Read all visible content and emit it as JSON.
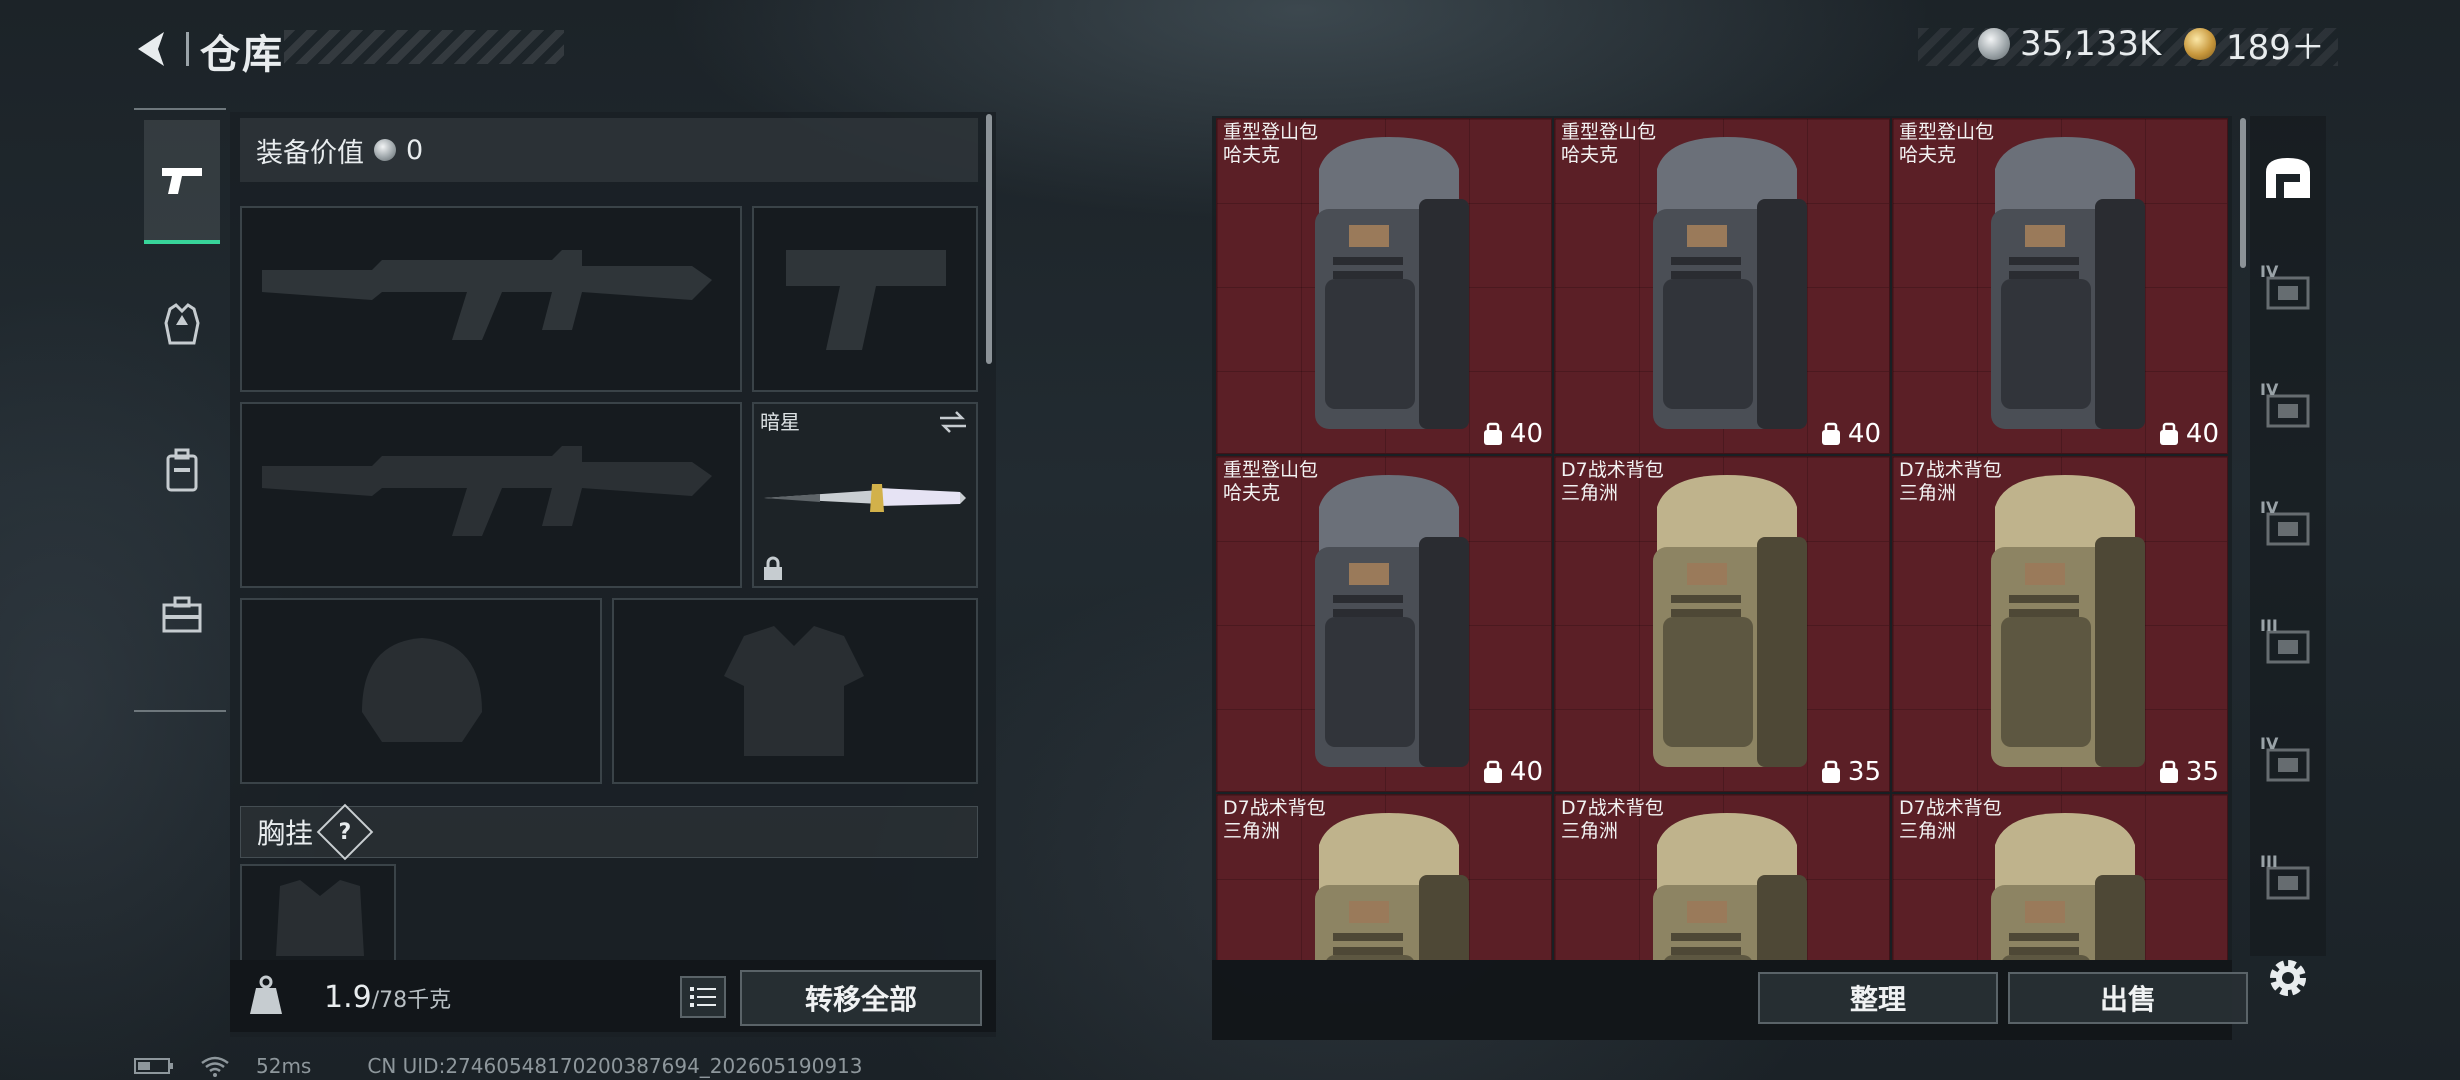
{
  "header": {
    "title": "仓库",
    "currency_silver": "35,133K",
    "currency_gold": "189＋"
  },
  "left_rail": {
    "tabs": [
      "weapon-icon",
      "armor-icon",
      "backpack-icon",
      "toolbox-icon"
    ],
    "active": 0
  },
  "equipment": {
    "value_label": "装备价值",
    "value_amount": "0",
    "melee_name": "暗星",
    "chest_rig_label": "胸挂",
    "help_label": "?"
  },
  "left_bottom": {
    "weight_current": "1.9",
    "weight_max": "/78千克",
    "transfer_all": "转移全部"
  },
  "storage": {
    "items": [
      {
        "line1": "重型登山包",
        "line2": "哈夫克",
        "capacity": "40",
        "variant": "gray"
      },
      {
        "line1": "重型登山包",
        "line2": "哈夫克",
        "capacity": "40",
        "variant": "gray"
      },
      {
        "line1": "重型登山包",
        "line2": "哈夫克",
        "capacity": "40",
        "variant": "gray"
      },
      {
        "line1": "重型登山包",
        "line2": "哈夫克",
        "capacity": "40",
        "variant": "gray"
      },
      {
        "line1": "D7战术背包",
        "line2": "三角洲",
        "capacity": "35",
        "variant": "tan"
      },
      {
        "line1": "D7战术背包",
        "line2": "三角洲",
        "capacity": "35",
        "variant": "tan"
      },
      {
        "line1": "D7战术背包",
        "line2": "三角洲",
        "capacity": "",
        "variant": "tan"
      },
      {
        "line1": "D7战术背包",
        "line2": "三角洲",
        "capacity": "",
        "variant": "tan"
      },
      {
        "line1": "D7战术背包",
        "line2": "三角洲",
        "capacity": "",
        "variant": "tan"
      }
    ],
    "sort_button": "整理",
    "sell_button": "出售"
  },
  "side_rail": {
    "icons": [
      "storage-home-icon",
      "tier-iv-case-icon",
      "tier-iv-add-icon",
      "tier-iv-folder-icon",
      "tier-iii-box-icon",
      "tier-iv-add-icon-2",
      "tier-iii-box-icon-2"
    ],
    "tier_labels": [
      "IV",
      "IV",
      "IV",
      "III",
      "IV",
      "III"
    ]
  },
  "status_bar": {
    "ping": "52ms",
    "uid": "CN UID:27460548170200387694_202605190913"
  },
  "colors": {
    "accent_green": "#38d49a",
    "storage_cell_red": "#5b1f26"
  }
}
